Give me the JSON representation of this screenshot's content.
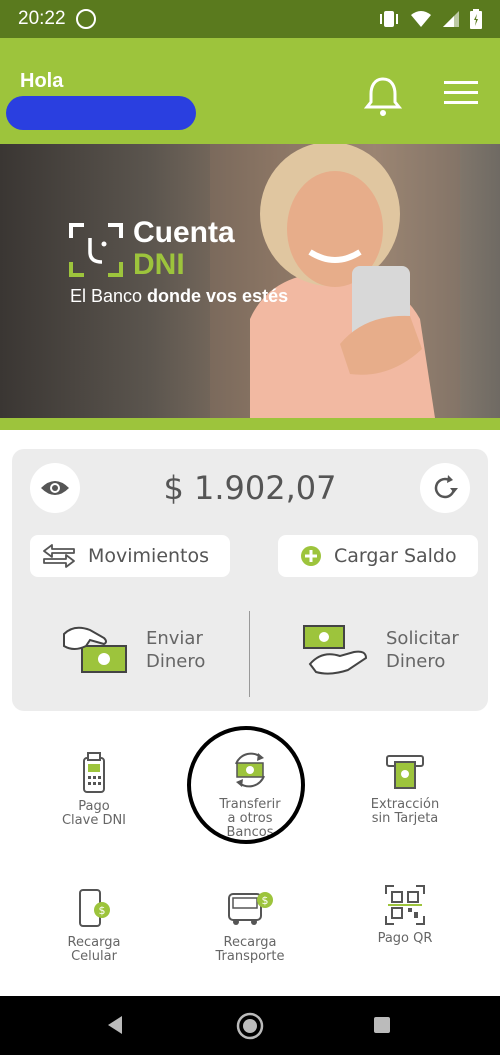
{
  "status_bar": {
    "time": "20:22"
  },
  "header": {
    "greeting": "Hola"
  },
  "hero": {
    "brand_line1": "Cuenta",
    "brand_line2": "DNI",
    "tagline_prefix": "El Banco ",
    "tagline_bold": "donde vos estés"
  },
  "balance": {
    "amount": "$ 1.902,07"
  },
  "actions": {
    "movimientos": "Movimientos",
    "cargar_saldo": "Cargar Saldo"
  },
  "main_actions": {
    "enviar": "Enviar\nDinero",
    "solicitar": "Solicitar\nDinero"
  },
  "grid": {
    "pago_clave": "Pago\nClave DNI",
    "transferir": "Transferir\na otros\nBancos",
    "extraccion": "Extracción\nsin Tarjeta",
    "recarga_celular": "Recarga\nCelular",
    "recarga_transporte": "Recarga\nTransporte",
    "pago_qr": "Pago QR"
  },
  "colors": {
    "brand_green": "#9dc43c",
    "status_bar": "#5a7a1e",
    "card_bg": "#ececec"
  }
}
